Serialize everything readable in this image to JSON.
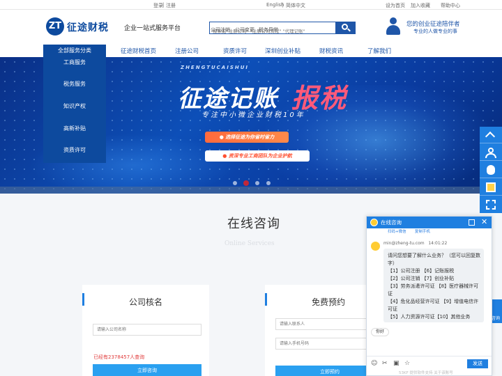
{
  "topbar": {
    "login": "登录",
    "sep1": "|",
    "register": "注册",
    "english": "English",
    "sep2": "|",
    "chinese": "简体中文",
    "homepage": "设为首页",
    "favorite": "加入收藏",
    "help": "帮助中心"
  },
  "header": {
    "logo_mark": "ZT",
    "logo_text": "征途财税",
    "slogan": "企业一站式服务平台",
    "search_placeholder": "搜索如\"注册公司\" \"注册公司流程\" \"代理记账\"",
    "hot_links": [
      "公司注销",
      "公司变更",
      "税务异常"
    ],
    "companion_title": "您的创业征途陪伴者",
    "companion_sub": "专业的人做专业的事"
  },
  "nav": {
    "all_label": "全部服务分类",
    "items": [
      "征途财税首页",
      "注册公司",
      "资质许可",
      "深圳创业补贴",
      "财税资讯",
      "了解我们"
    ]
  },
  "categories": [
    "工商服务",
    "税务服务",
    "知识产权",
    "高新补贴",
    "资质许可"
  ],
  "banner": {
    "pinyin": "ZHENGTUCAISHUI",
    "title_a": "征途记账",
    "title_b": "报税",
    "subtitle": "专注中小微企业财税10年",
    "pill1": "● 选择征途为你省时省力",
    "pill2": "● 资深专业工商团队为企业护航"
  },
  "consult": {
    "title": "在线咨询",
    "subtitle": "Online Services"
  },
  "card_left": {
    "title": "公司核名",
    "input_placeholder": "请输入公司名称",
    "count_text": "已经有2378457人查询",
    "submit": "立即咨询"
  },
  "card_right": {
    "title": "免费预约",
    "name_placeholder": "请输入联系人",
    "phone_placeholder": "请输入手机号码",
    "submit": "立即预约"
  },
  "chat": {
    "title": "在线咨询",
    "tool1": "扫码+微信",
    "tool2": "复制手机",
    "agent_email": "min@zheng-tu.com",
    "time": "14:01:22",
    "lines": [
      "请问您想要了解什么业务？（您可以回复数",
      "字）",
      "【1】公司注册 【6】记账报税",
      "【2】公司注销 【7】创业补贴",
      "【3】劳务派遣许可证 【8】医疗器械许可",
      "证",
      "【4】危化品经营许可证 【9】增值电信许",
      "可证",
      "【5】人力资源许可证【10】其他业务"
    ],
    "quick_reply": "你好",
    "send": "发送",
    "footer": "53KF 提供软件支持  关于该账号"
  },
  "side_consult": "咨询"
}
